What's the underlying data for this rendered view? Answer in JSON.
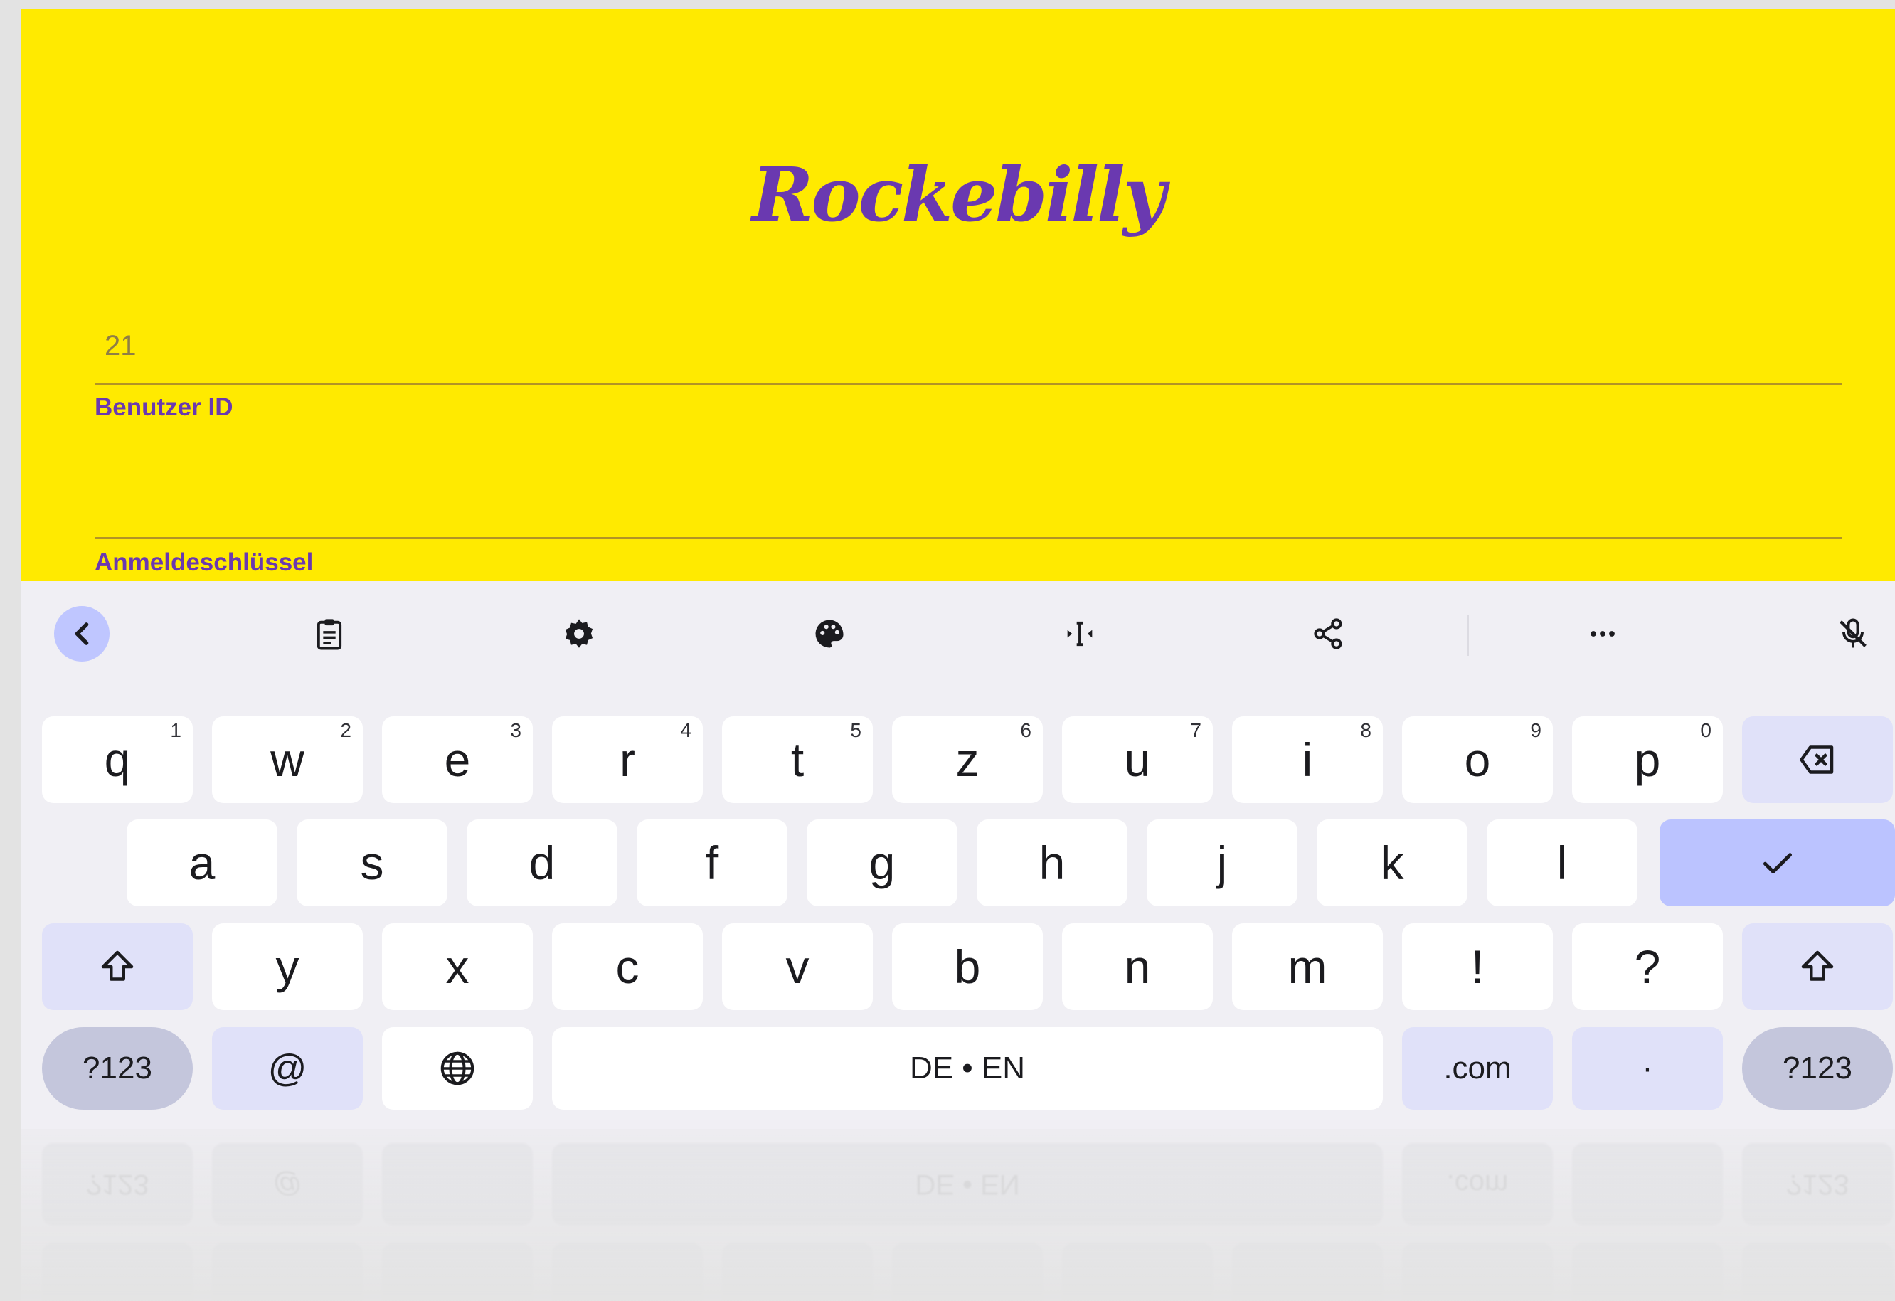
{
  "app": {
    "title": "Rockebilly",
    "user_id_value": "21",
    "user_id_label": "Benutzer ID",
    "password_value": "",
    "password_label": "Anmeldeschlüssel"
  },
  "keyboard": {
    "toolbar": [
      "back-icon",
      "clipboard-icon",
      "settings-icon",
      "palette-icon",
      "text-cursor-icon",
      "share-icon",
      "more-icon",
      "mic-off-icon"
    ],
    "row1": [
      {
        "key": "q",
        "hint": "1"
      },
      {
        "key": "w",
        "hint": "2"
      },
      {
        "key": "e",
        "hint": "3"
      },
      {
        "key": "r",
        "hint": "4"
      },
      {
        "key": "t",
        "hint": "5"
      },
      {
        "key": "z",
        "hint": "6"
      },
      {
        "key": "u",
        "hint": "7"
      },
      {
        "key": "i",
        "hint": "8"
      },
      {
        "key": "o",
        "hint": "9"
      },
      {
        "key": "p",
        "hint": "0"
      }
    ],
    "row2": [
      "a",
      "s",
      "d",
      "f",
      "g",
      "h",
      "j",
      "k",
      "l"
    ],
    "row3": [
      "y",
      "x",
      "c",
      "v",
      "b",
      "n",
      "m",
      "!",
      "?"
    ],
    "symbols_label": "?123",
    "at_label": "@",
    "space_label": "DE • EN",
    "dotcom_label": ".com",
    "period_label": "·"
  },
  "colors": {
    "app_background": "#ffea00",
    "brand_purple": "#6a39b0",
    "keyboard_background": "#f0eff4",
    "accent_key": "#bbc3ff"
  }
}
